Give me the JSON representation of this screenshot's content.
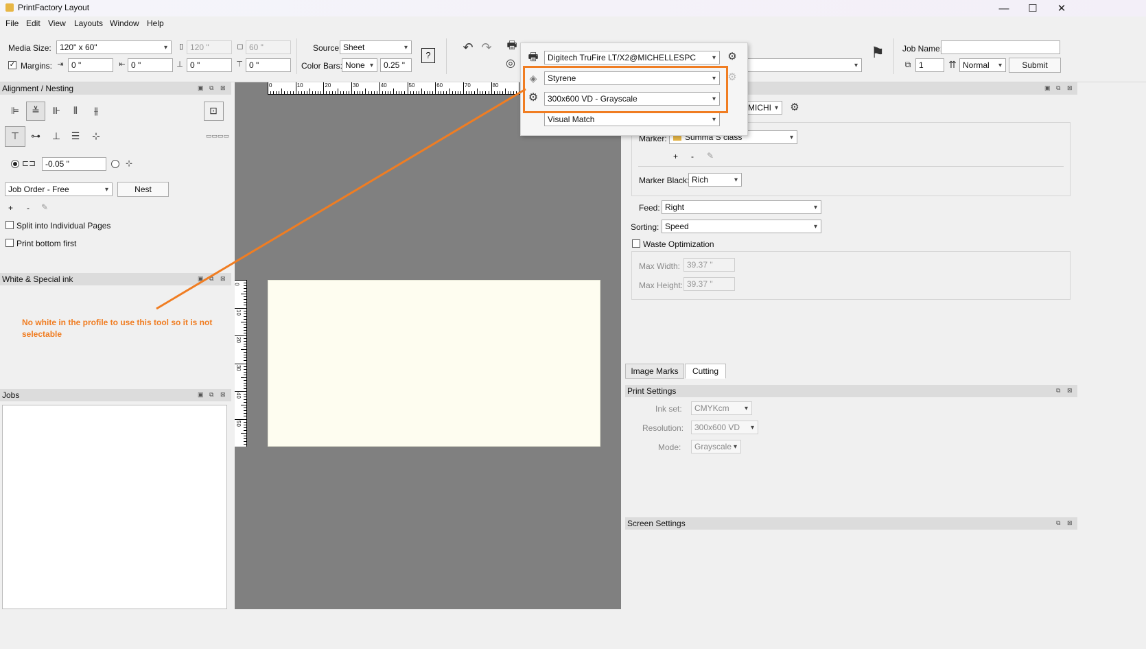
{
  "window": {
    "title": "PrintFactory Layout",
    "minimize": "—",
    "maximize": "☐",
    "close": "✕"
  },
  "menu": [
    "File",
    "Edit",
    "View",
    "Layouts",
    "Window",
    "Help"
  ],
  "toolbar": {
    "media_size_label": "Media Size:",
    "media_size_value": "120\" x 60\"",
    "width_value": "120 \"",
    "height_value": "60 \"",
    "margins_label": "Margins:",
    "margin_left": "0 \"",
    "margin_right": "0 \"",
    "margin_bottom": "0 \"",
    "margin_top": "0 \"",
    "source_label": "Source:",
    "source_value": "Sheet",
    "color_bars_label": "Color Bars:",
    "color_bars_value": "None",
    "color_bars_size": "0.25 \"",
    "job_name_label": "Job Name:",
    "job_name_value": "",
    "copies_value": "1",
    "priority_value": "Normal",
    "submit_label": "Submit"
  },
  "popup": {
    "printer": "Digitech TruFire LT/X2@MICHELLESPC",
    "media": "Styrene",
    "resolution": "300x600 VD - Grayscale",
    "color_mode": "Visual Match"
  },
  "alignment_panel": {
    "title": "Alignment / Nesting",
    "spacing_value": "-0.05 \"",
    "job_order_value": "Job Order - Free",
    "nest_label": "Nest",
    "add": "+",
    "remove": "-",
    "split_label": "Split into Individual Pages",
    "print_bottom_label": "Print bottom first"
  },
  "white_panel": {
    "title": "White & Special ink"
  },
  "annotation": "No white in the profile to use this tool so it is not selectable",
  "jobs_panel": {
    "title": "Jobs"
  },
  "ruler": {
    "h_labels": [
      "0",
      "10",
      "20",
      "30",
      "40",
      "50",
      "60",
      "70",
      "80",
      "9"
    ],
    "v_labels": [
      "0",
      "10",
      "20",
      "30",
      "40",
      "50"
    ]
  },
  "cutting_panel": {
    "cutter_value": "MICHI",
    "marker_label": "Marker:",
    "marker_value": "Summa S class",
    "add": "+",
    "remove": "-",
    "marker_black_label": "Marker Black:",
    "marker_black_value": "Rich",
    "feed_label": "Feed:",
    "feed_value": "Right",
    "sorting_label": "Sorting:",
    "sorting_value": "Speed",
    "waste_label": "Waste Optimization",
    "max_width_label": "Max Width:",
    "max_width_value": "39.37 \"",
    "max_height_label": "Max Height:",
    "max_height_value": "39.37 \""
  },
  "tabs": [
    "Image Marks",
    "Cutting"
  ],
  "print_settings": {
    "title": "Print Settings",
    "ink_set_label": "Ink set:",
    "ink_set_value": "CMYKcm",
    "resolution_label": "Resolution:",
    "resolution_value": "300x600 VD",
    "mode_label": "Mode:",
    "mode_value": "Grayscale"
  },
  "screen_settings": {
    "title": "Screen Settings"
  },
  "colors": {
    "accent": "#f07d22",
    "canvas": "#808080",
    "sheet": "#fefdf0"
  }
}
